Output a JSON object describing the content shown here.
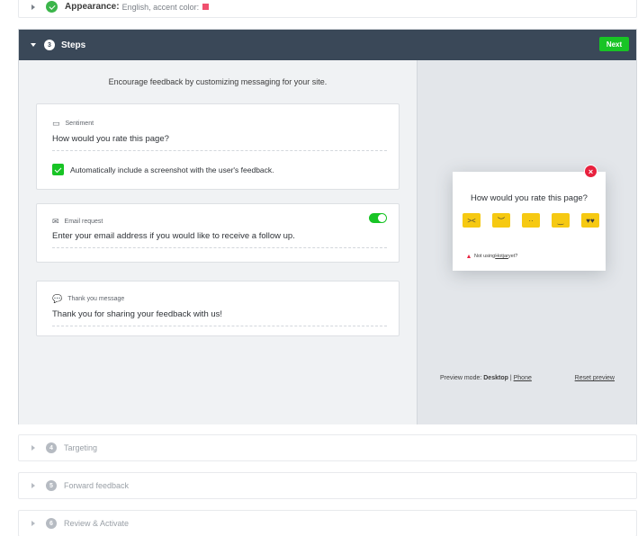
{
  "appearance": {
    "title": "Appearance:",
    "subtitle": "English, accent color:",
    "accent_color": "#f0506e"
  },
  "steps": {
    "number": "3",
    "title": "Steps",
    "next_label": "Next",
    "intro": "Encourage feedback by customizing messaging for your site.",
    "cards": [
      {
        "label": "Sentiment",
        "text": "How would you rate this page?",
        "checkbox_label": "Automatically include a screenshot with the user's feedback."
      },
      {
        "label": "Email request",
        "text": "Enter your email address if you would like to receive a follow up."
      },
      {
        "label": "Thank you message",
        "text": "Thank you for sharing your feedback with us!"
      }
    ]
  },
  "preview": {
    "question": "How would you rate this page?",
    "close": "×",
    "footer_prefix": "Not using ",
    "footer_link": "Hotjar",
    "footer_suffix": " yet?",
    "mode_label": "Preview mode:",
    "mode_desktop": "Desktop",
    "mode_sep": "|",
    "mode_phone": "Phone",
    "reset": "Reset preview"
  },
  "collapsed_steps": [
    {
      "number": "4",
      "title": "Targeting"
    },
    {
      "number": "5",
      "title": "Forward feedback"
    },
    {
      "number": "6",
      "title": "Review & Activate"
    }
  ]
}
